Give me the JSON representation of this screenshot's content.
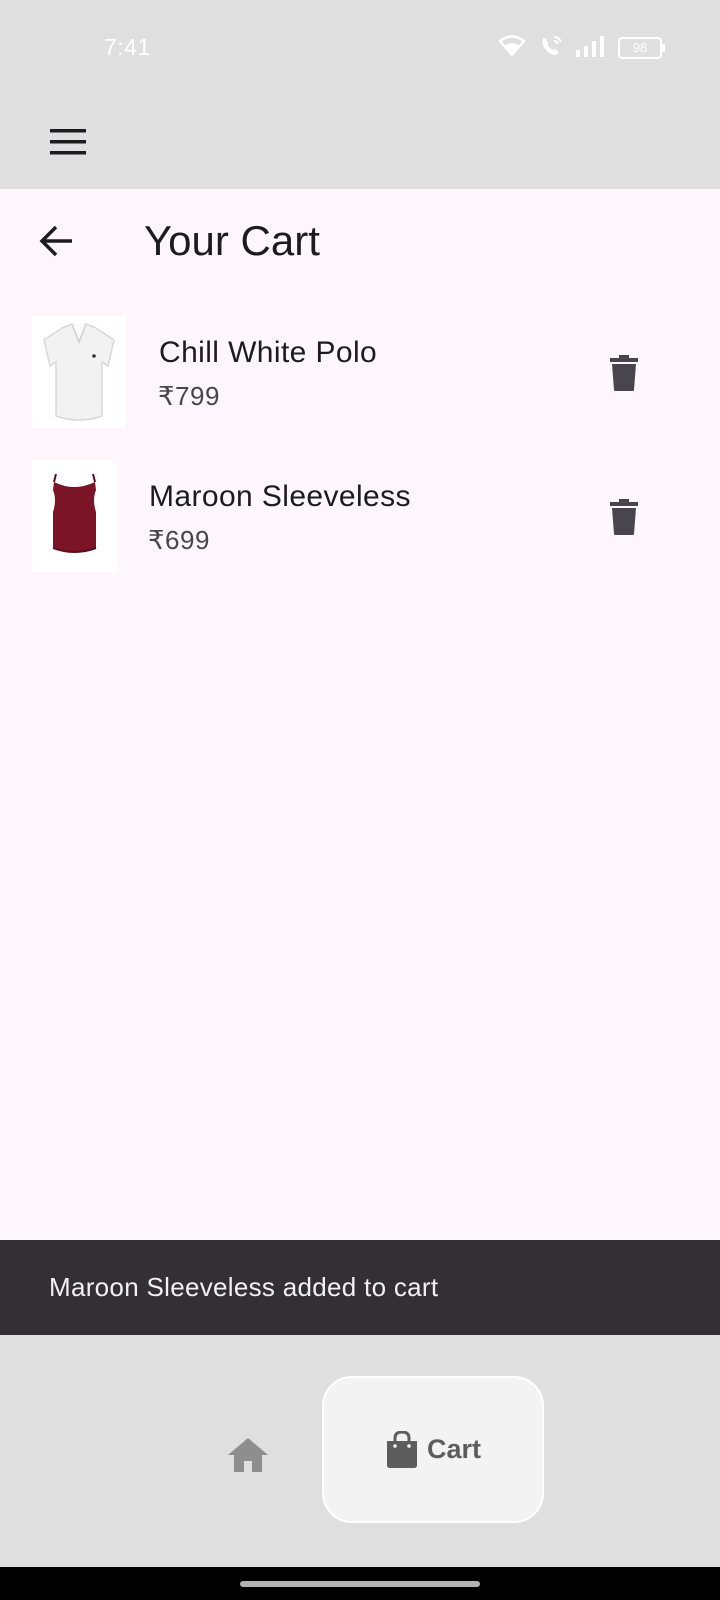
{
  "status_bar": {
    "time": "7:41",
    "battery": "98",
    "icons": [
      "wifi-icon",
      "wifi-call-icon",
      "signal-icon",
      "battery-icon"
    ]
  },
  "top_bar": {
    "menu_icon": "hamburger-menu-icon"
  },
  "cart": {
    "title": "Your Cart",
    "items": [
      {
        "name": "Chill White Polo",
        "price": "₹799",
        "thumbnail": "white-polo-shirt",
        "color": "#f2f2f2"
      },
      {
        "name": "Maroon Sleeveless",
        "price": "₹699",
        "thumbnail": "maroon-sleeveless-top",
        "color": "#7a1426"
      }
    ]
  },
  "snackbar": {
    "message": "Maroon Sleeveless added to cart"
  },
  "bottom_nav": {
    "items": [
      {
        "icon": "home-icon",
        "label": ""
      },
      {
        "icon": "shopping-bag-icon",
        "label": "Cart"
      }
    ],
    "selected": "Cart"
  },
  "colors": {
    "background": "#fdf7fd",
    "bars": "#dfdfdf",
    "snackbar": "#322f35",
    "text_primary": "#1c1b1f",
    "text_secondary": "#49454f",
    "icon": "#49454f"
  }
}
